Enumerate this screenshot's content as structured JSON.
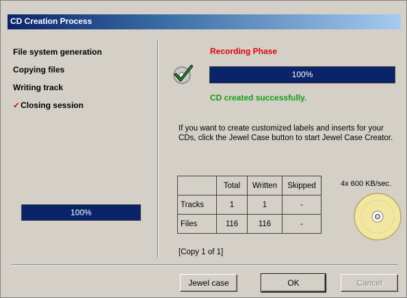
{
  "window": {
    "title": "CD Creation Process"
  },
  "steps": [
    {
      "label": "File system generation",
      "done": false
    },
    {
      "label": "Copying files",
      "done": false
    },
    {
      "label": "Writing track",
      "done": false
    },
    {
      "label": "Closing session",
      "done": true
    }
  ],
  "left_progress": {
    "text": "100%",
    "value": 1.0
  },
  "phase": {
    "title": "Recording Phase",
    "progress_text": "100%",
    "progress_value": 1.0,
    "status": "CD created successfully."
  },
  "info_text": "If you want to create customized labels and inserts for your CDs, click the Jewel Case button to start Jewel Case Creator.",
  "speed": "4x 600 KB/sec.",
  "stats": {
    "headers": [
      "",
      "Total",
      "Written",
      "Skipped"
    ],
    "rows": [
      [
        "Tracks",
        "1",
        "1",
        "-"
      ],
      [
        "Files",
        "116",
        "116",
        "-"
      ]
    ]
  },
  "copy_status": "[Copy 1 of 1]",
  "buttons": {
    "jewel_case": "Jewel case",
    "ok": "OK",
    "cancel": "Cancel"
  },
  "colors": {
    "title_bar": "#0a246a",
    "phase_title": "#e00000",
    "success": "#10a010",
    "progress_fill": "#0a246a"
  },
  "icons": {
    "status": "cd-check-icon",
    "drive": "cd-disc-icon",
    "step_done": "check-mark-icon"
  }
}
